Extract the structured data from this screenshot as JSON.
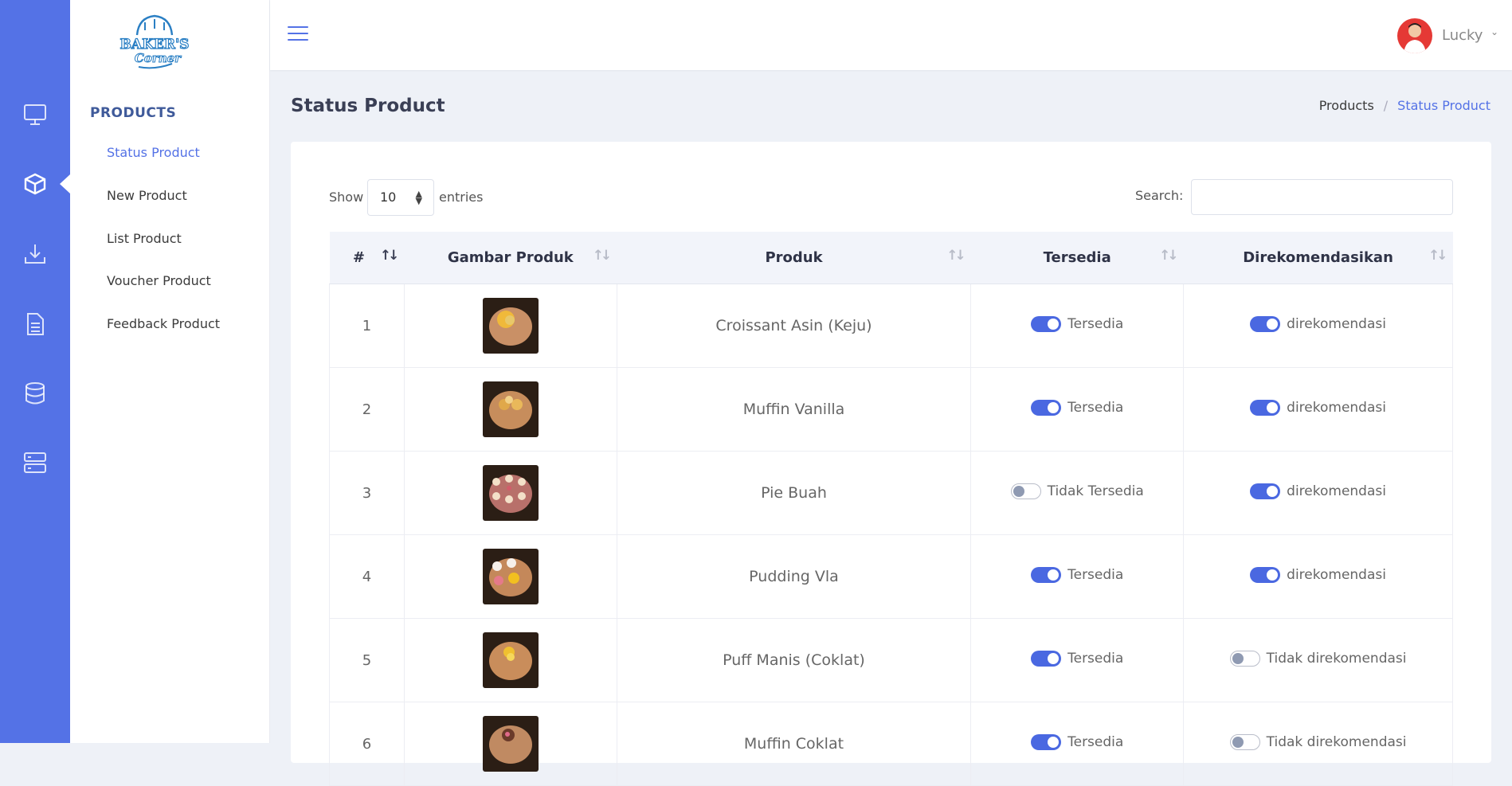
{
  "brand": {
    "logo_text": "BAKER'S Corner"
  },
  "rail": {
    "icons": [
      "monitor-icon",
      "box-icon",
      "download-icon",
      "document-icon",
      "database-icon",
      "server-icon"
    ],
    "accent": "#5472e6"
  },
  "sidebar": {
    "section_title": "PRODUCTS",
    "items": [
      {
        "label": "Status Product",
        "active": true
      },
      {
        "label": "New Product",
        "active": false
      },
      {
        "label": "List Product",
        "active": false
      },
      {
        "label": "Voucher Product",
        "active": false
      },
      {
        "label": "Feedback Product",
        "active": false
      }
    ]
  },
  "topbar": {
    "user_name": "Lucky"
  },
  "page": {
    "title": "Status Product",
    "breadcrumb": [
      "Products",
      "Status Product"
    ]
  },
  "table_controls": {
    "show_label": "Show",
    "entries_value": "10",
    "entries_label": "entries",
    "search_label": "Search:",
    "search_value": ""
  },
  "table": {
    "headers": [
      "#",
      "Gambar Produk",
      "Produk",
      "Tersedia",
      "Direkomendasikan"
    ],
    "rows": [
      {
        "no": "1",
        "produk": "Croissant Asin (Keju)",
        "tersedia": true,
        "tersedia_label": "Tersedia",
        "rekomendasi": true,
        "rekomendasi_label": "direkomendasi"
      },
      {
        "no": "2",
        "produk": "Muffin Vanilla",
        "tersedia": true,
        "tersedia_label": "Tersedia",
        "rekomendasi": true,
        "rekomendasi_label": "direkomendasi"
      },
      {
        "no": "3",
        "produk": "Pie Buah",
        "tersedia": false,
        "tersedia_label": "Tidak Tersedia",
        "rekomendasi": true,
        "rekomendasi_label": "direkomendasi"
      },
      {
        "no": "4",
        "produk": "Pudding Vla",
        "tersedia": true,
        "tersedia_label": "Tersedia",
        "rekomendasi": true,
        "rekomendasi_label": "direkomendasi"
      },
      {
        "no": "5",
        "produk": "Puff Manis (Coklat)",
        "tersedia": true,
        "tersedia_label": "Tersedia",
        "rekomendasi": false,
        "rekomendasi_label": "Tidak direkomendasi"
      },
      {
        "no": "6",
        "produk": "Muffin Coklat",
        "tersedia": true,
        "tersedia_label": "Tersedia",
        "rekomendasi": false,
        "rekomendasi_label": "Tidak direkomendasi"
      }
    ]
  }
}
